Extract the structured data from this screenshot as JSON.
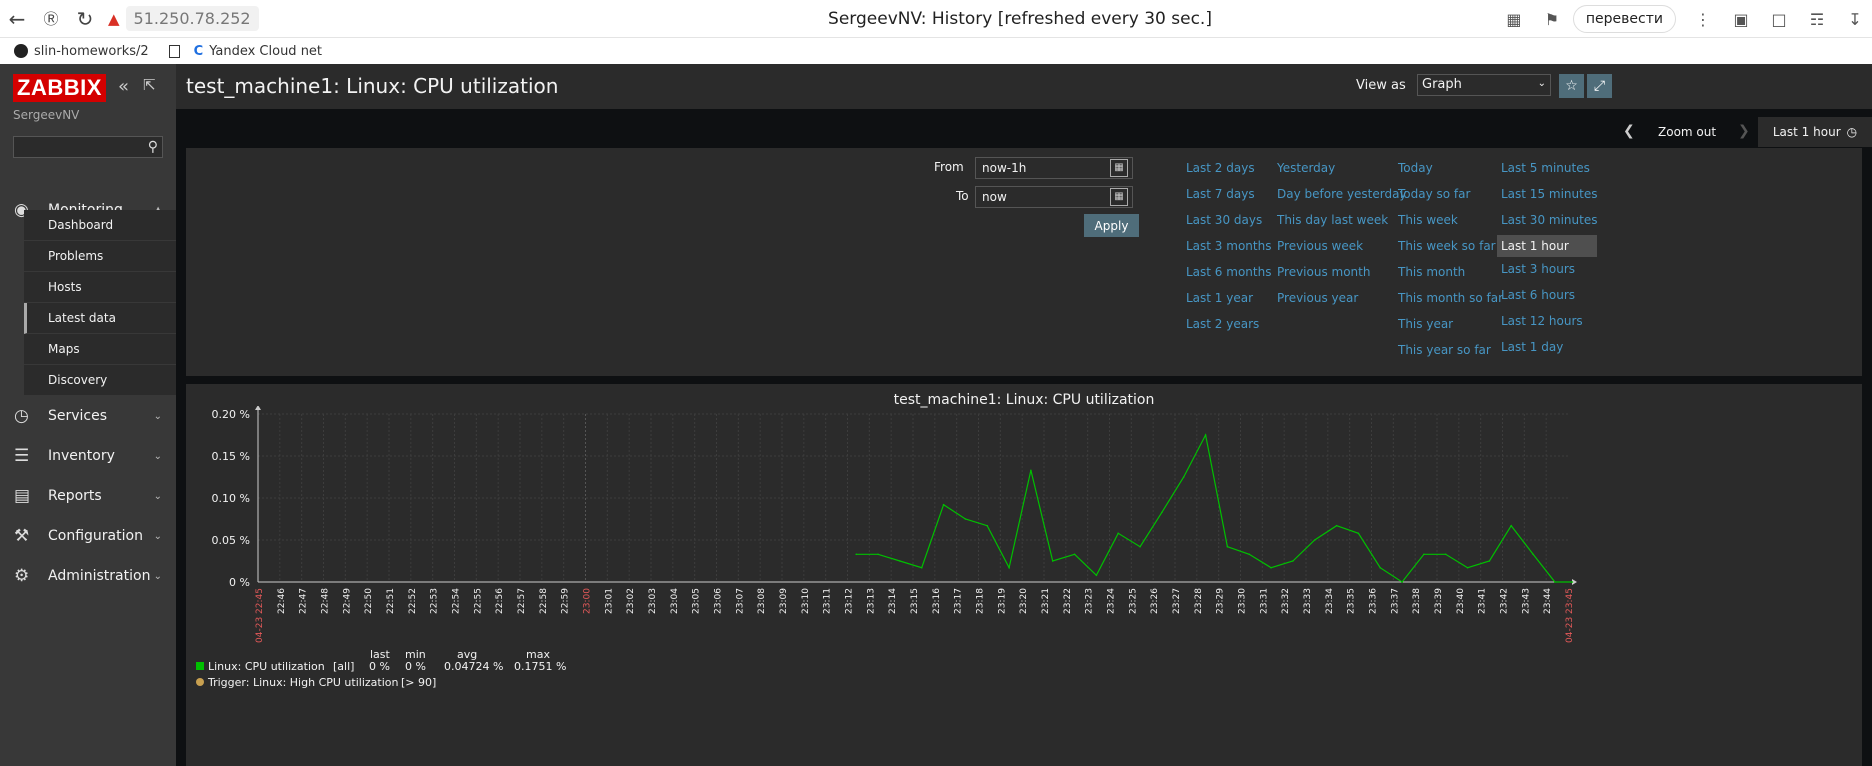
{
  "browser": {
    "address": "51.250.78.252",
    "tab_title": "SergeevNV: History [refreshed every 30 sec.]",
    "translate_label": "перевести",
    "bookmarks": [
      "slin-homeworks/2",
      "Yandex Cloud net"
    ]
  },
  "sidebar": {
    "logo": "ZABBIX",
    "user": "SergeevNV",
    "search_placeholder": "",
    "sections": [
      {
        "label": "Monitoring",
        "icon": "eye-icon"
      },
      {
        "label": "Services",
        "icon": "clock-icon"
      },
      {
        "label": "Inventory",
        "icon": "list-icon"
      },
      {
        "label": "Reports",
        "icon": "bar-chart-icon"
      },
      {
        "label": "Configuration",
        "icon": "wrench-icon"
      },
      {
        "label": "Administration",
        "icon": "gear-icon"
      }
    ],
    "monitoring_items": [
      "Dashboard",
      "Problems",
      "Hosts",
      "Latest data",
      "Maps",
      "Discovery"
    ],
    "active_item": "Latest data"
  },
  "header": {
    "title": "test_machine1: Linux: CPU utilization",
    "view_as_label": "View as",
    "view_as_value": "Graph"
  },
  "timeframe": {
    "zoom_out": "Zoom out",
    "active_tab": "Last 1 hour",
    "from_label": "From",
    "from_value": "now-1h",
    "to_label": "To",
    "to_value": "now",
    "apply_label": "Apply",
    "quick": [
      [
        "Last 2 days",
        "Last 7 days",
        "Last 30 days",
        "Last 3 months",
        "Last 6 months",
        "Last 1 year",
        "Last 2 years"
      ],
      [
        "Yesterday",
        "Day before yesterday",
        "This day last week",
        "Previous week",
        "Previous month",
        "Previous year"
      ],
      [
        "Today",
        "Today so far",
        "This week",
        "This week so far",
        "This month",
        "This month so far",
        "This year",
        "This year so far"
      ],
      [
        "Last 5 minutes",
        "Last 15 minutes",
        "Last 30 minutes",
        "Last 1 hour",
        "Last 3 hours",
        "Last 6 hours",
        "Last 12 hours",
        "Last 1 day"
      ]
    ],
    "selected_quick": "Last 1 hour"
  },
  "chart_data": {
    "type": "line",
    "title": "test_machine1: Linux: CPU utilization",
    "ylim": [
      0,
      0.2
    ],
    "yticks": [
      "0 %",
      "0.05 %",
      "0.10 %",
      "0.15 %",
      "0.20 %"
    ],
    "start_label": "04-23 22:45",
    "end_label": "04-23 23:45",
    "x_ticks": [
      "22:46",
      "22:47",
      "22:48",
      "22:49",
      "22:50",
      "22:51",
      "22:52",
      "22:53",
      "22:54",
      "22:55",
      "22:56",
      "22:57",
      "22:58",
      "22:59",
      "23:00",
      "23:01",
      "23:02",
      "23:03",
      "23:04",
      "23:05",
      "23:06",
      "23:07",
      "23:08",
      "23:09",
      "23:10",
      "23:11",
      "23:12",
      "23:13",
      "23:14",
      "23:15",
      "23:16",
      "23:17",
      "23:18",
      "23:19",
      "23:20",
      "23:21",
      "23:22",
      "23:23",
      "23:24",
      "23:25",
      "23:26",
      "23:27",
      "23:28",
      "23:29",
      "23:30",
      "23:31",
      "23:32",
      "23:33",
      "23:34",
      "23:35",
      "23:36",
      "23:37",
      "23:38",
      "23:39",
      "23:40",
      "23:41",
      "23:42",
      "23:43",
      "23:44"
    ],
    "series": [
      {
        "name": "Linux: CPU utilization",
        "color": "#00c000",
        "x": [
          27.4,
          28.4,
          29.4,
          30.4,
          31.4,
          32.4,
          33.4,
          34.4,
          35.4,
          36.4,
          37.4,
          38.4,
          39.4,
          40.4,
          41.4,
          42.4,
          43.4,
          44.4,
          45.4,
          46.4,
          47.4,
          48.4,
          49.4,
          50.4,
          51.4,
          52.4,
          53.4,
          54.4,
          55.4,
          56.4,
          57.4,
          58.4,
          59.4,
          60.2
        ],
        "values": [
          0.033,
          0.033,
          0.025,
          0.017,
          0.092,
          0.075,
          0.067,
          0.017,
          0.133,
          0.025,
          0.033,
          0.008,
          0.058,
          0.042,
          0.083,
          0.125,
          0.175,
          0.042,
          0.033,
          0.017,
          0.025,
          0.05,
          0.067,
          0.058,
          0.017,
          0.0,
          0.033,
          0.033,
          0.017,
          0.025,
          0.067,
          0.033,
          0.0,
          0.0
        ]
      }
    ],
    "legend": {
      "headers": [
        "last",
        "min",
        "avg",
        "max"
      ],
      "series_label": "Linux: CPU utilization",
      "series_scope": "[all]",
      "last": "0 %",
      "min": "0 %",
      "avg": "0.04724 %",
      "max": "0.1751 %",
      "trigger_label": "Trigger: Linux: High CPU utilization",
      "trigger_value": "[> 90]",
      "trigger_color": "#c8a050"
    }
  }
}
